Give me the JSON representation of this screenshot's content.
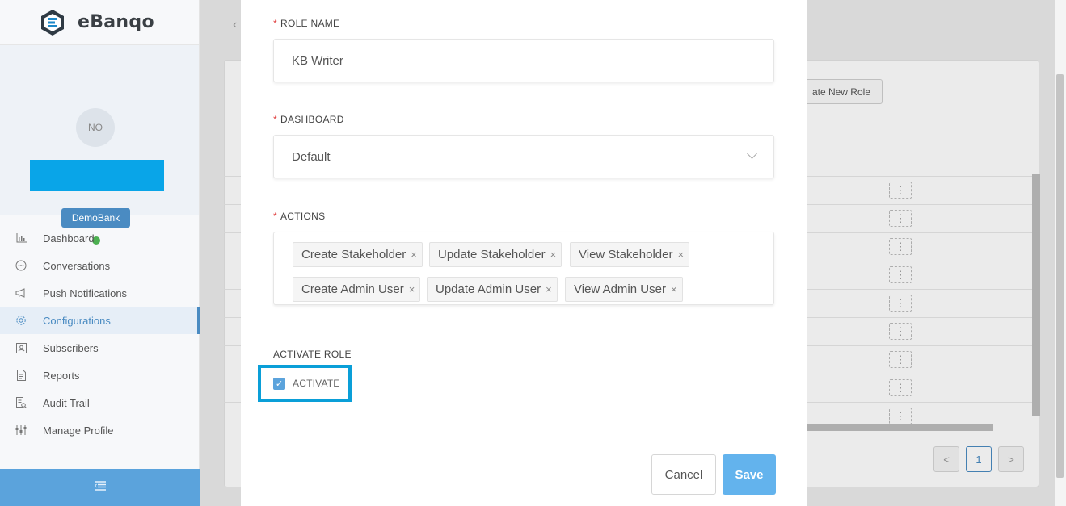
{
  "brand": {
    "name": "eBanqo"
  },
  "profile": {
    "initials": "NO",
    "bank": "DemoBank"
  },
  "sidebar": {
    "items": [
      {
        "label": "Dashboard",
        "icon": "bar-chart-icon"
      },
      {
        "label": "Conversations",
        "icon": "chat-icon"
      },
      {
        "label": "Push Notifications",
        "icon": "megaphone-icon"
      },
      {
        "label": "Configurations",
        "icon": "gear-icon",
        "active": true
      },
      {
        "label": "Subscribers",
        "icon": "contact-card-icon"
      },
      {
        "label": "Reports",
        "icon": "document-icon"
      },
      {
        "label": "Audit Trail",
        "icon": "audit-icon"
      },
      {
        "label": "Manage Profile",
        "icon": "sliders-icon"
      }
    ],
    "footer_icon": "collapse-menu-icon"
  },
  "background": {
    "create_button_label": "ate New Role",
    "pagination": {
      "prev": "<",
      "current": "1",
      "next": ">"
    }
  },
  "modal": {
    "role_name": {
      "label": "ROLE NAME",
      "value": "KB Writer"
    },
    "dashboard": {
      "label": "DASHBOARD",
      "value": "Default"
    },
    "actions": {
      "label": "ACTIONS",
      "tags": [
        "Create Stakeholder",
        "Update Stakeholder",
        "View Stakeholder",
        "Create Admin User",
        "Update Admin User",
        "View Admin User"
      ]
    },
    "activate": {
      "section_label": "ACTIVATE ROLE",
      "checkbox_label": "ACTIVATE",
      "checked": true
    },
    "buttons": {
      "cancel": "Cancel",
      "save": "Save"
    }
  },
  "colors": {
    "accent": "#4a8bc2",
    "highlight_border": "#0a9fd8",
    "save_button": "#63b3ed",
    "required": "#e04040",
    "status_online": "#4caf50"
  }
}
